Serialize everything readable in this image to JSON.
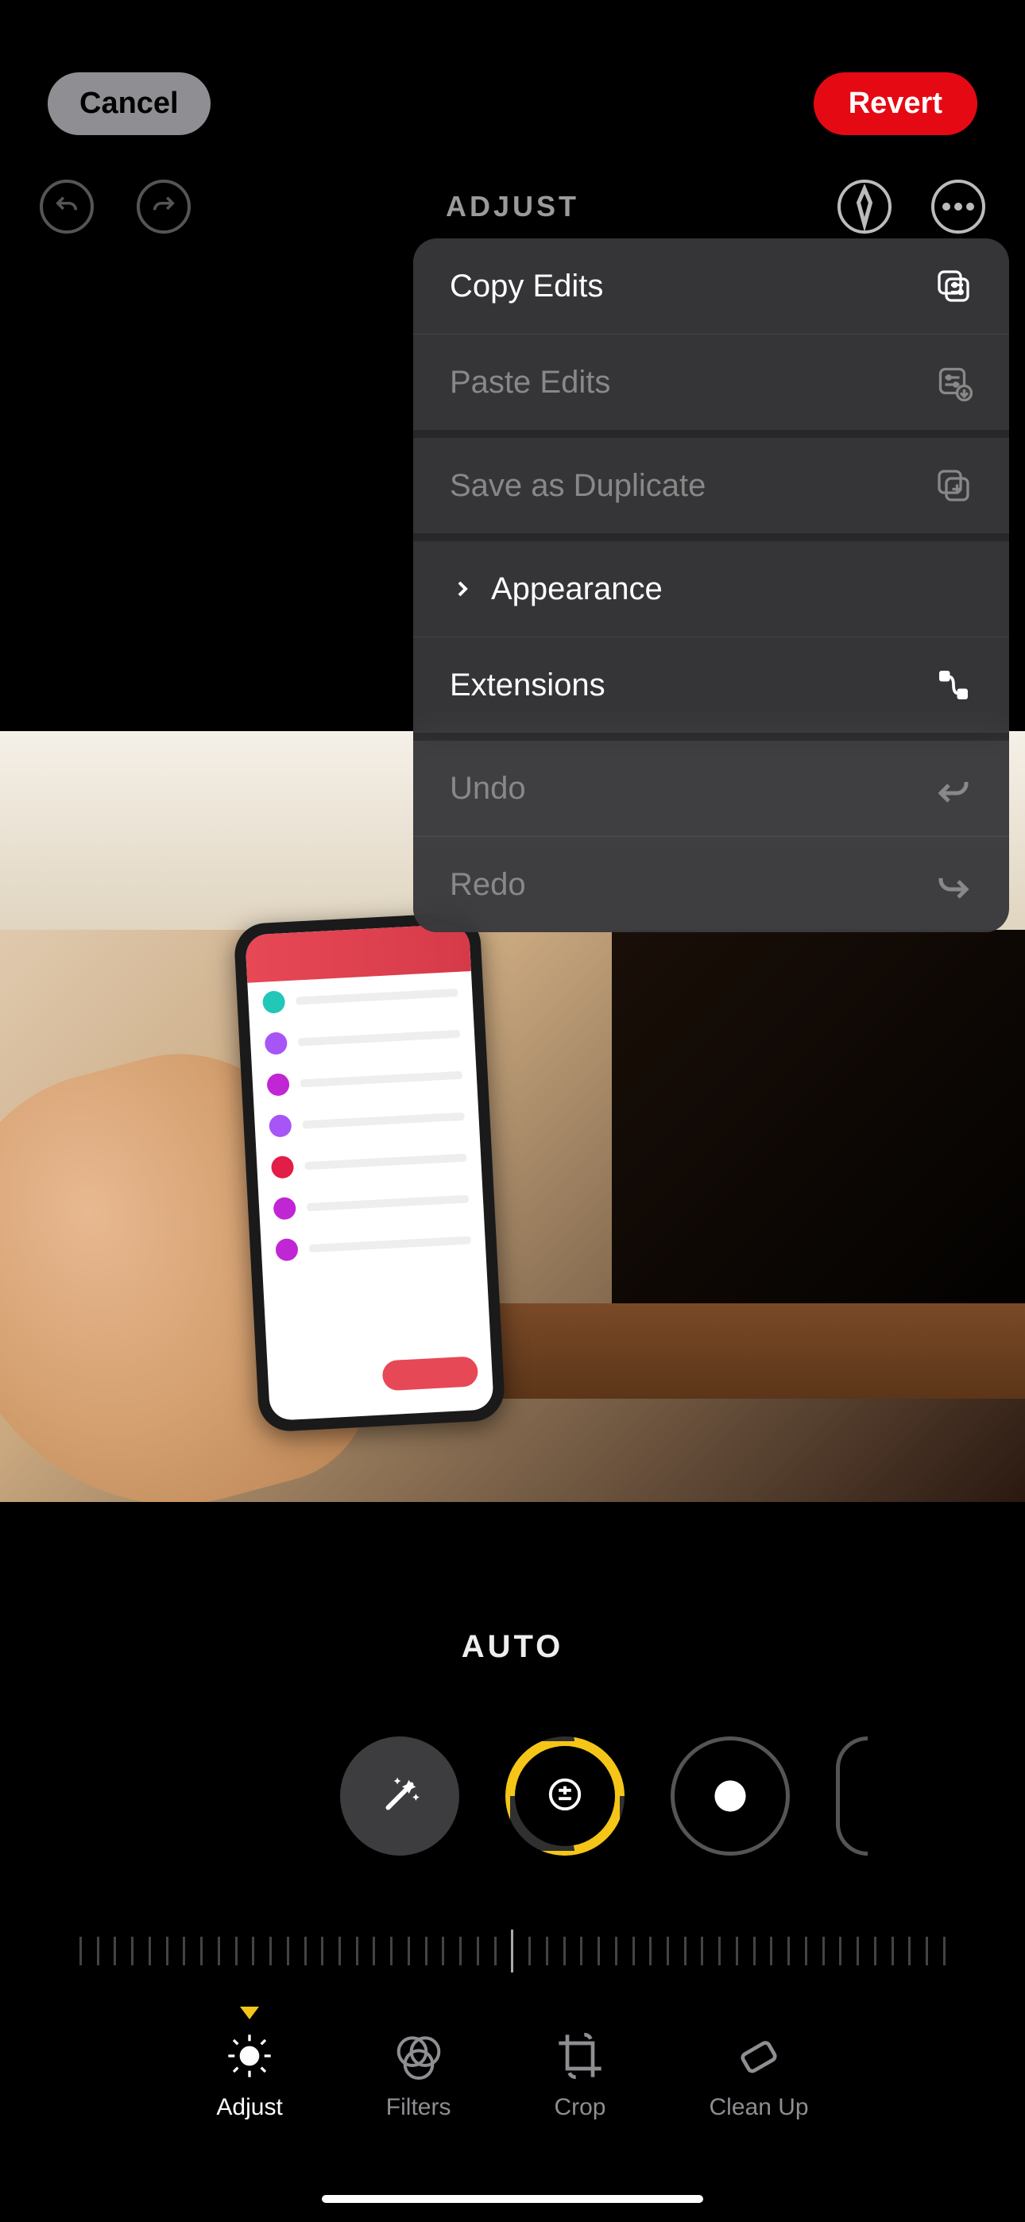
{
  "header": {
    "cancel_label": "Cancel",
    "revert_label": "Revert"
  },
  "subbar": {
    "title": "ADJUST"
  },
  "menu": {
    "items": [
      {
        "label": "Copy Edits",
        "enabled": true,
        "icon": "copy-edits-icon",
        "chevron": false,
        "sep": false
      },
      {
        "label": "Paste Edits",
        "enabled": false,
        "icon": "paste-edits-icon",
        "chevron": false,
        "sep": true
      },
      {
        "label": "Save as Duplicate",
        "enabled": false,
        "icon": "duplicate-icon",
        "chevron": false,
        "sep": true
      },
      {
        "label": "Appearance",
        "enabled": true,
        "icon": null,
        "chevron": true,
        "sep": false
      },
      {
        "label": "Extensions",
        "enabled": true,
        "icon": "extensions-icon",
        "chevron": false,
        "sep": true
      },
      {
        "label": "Undo",
        "enabled": false,
        "icon": "undo-icon",
        "chevron": false,
        "sep": false
      },
      {
        "label": "Redo",
        "enabled": false,
        "icon": "redo-icon",
        "chevron": false,
        "sep": false
      }
    ]
  },
  "current_control_label": "AUTO",
  "tabs": [
    {
      "label": "Adjust",
      "active": true
    },
    {
      "label": "Filters",
      "active": false
    },
    {
      "label": "Crop",
      "active": false
    },
    {
      "label": "Clean Up",
      "active": false
    }
  ]
}
